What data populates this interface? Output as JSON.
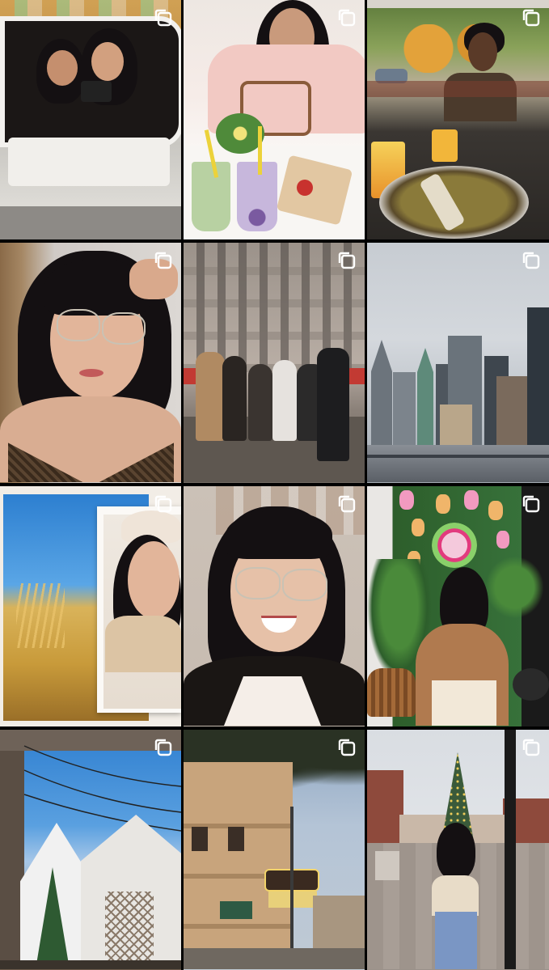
{
  "grid": {
    "posts": [
      {
        "name": "post-mirror-selfie",
        "colors": [
          "#c9c7c2",
          "#8f6a52",
          "#eae7e0"
        ]
      },
      {
        "name": "post-boba-drinks",
        "colors": [
          "#f4d8cf",
          "#b9d3a6",
          "#c7b7dc"
        ]
      },
      {
        "name": "post-patio-brunch",
        "colors": [
          "#6c8a4a",
          "#2b2a26",
          "#d89a4c"
        ]
      },
      {
        "name": "post-bedroom-selfie",
        "colors": [
          "#c5c0bc",
          "#3d2d22",
          "#e2b59a"
        ]
      },
      {
        "name": "post-group-photo",
        "colors": [
          "#b8ada4",
          "#6c5c4f",
          "#c23a33"
        ]
      },
      {
        "name": "post-city-skyline",
        "colors": [
          "#9aa3ad",
          "#5b6670",
          "#d4d8dd"
        ]
      },
      {
        "name": "post-wheat-field-frame",
        "colors": [
          "#3d8fd6",
          "#c89a3a",
          "#f2ede6"
        ]
      },
      {
        "name": "post-smile-selfie",
        "colors": [
          "#c7bbb0",
          "#141012",
          "#e6c1a8"
        ]
      },
      {
        "name": "post-boba-mural",
        "colors": [
          "#2d5e2b",
          "#f29ac0",
          "#b07a4f"
        ]
      },
      {
        "name": "post-string-lights-tent",
        "colors": [
          "#2f7fd0",
          "#f1f1f1",
          "#6b5a4a"
        ]
      },
      {
        "name": "post-theatre-street",
        "colors": [
          "#c8a47c",
          "#7a6a5a",
          "#e8d07a"
        ]
      },
      {
        "name": "post-christmas-tree-plaza",
        "colors": [
          "#d9dde2",
          "#8e4a3c",
          "#3a5a3a"
        ]
      }
    ]
  },
  "icons": {
    "multi_post": "multiple-posts-icon"
  }
}
